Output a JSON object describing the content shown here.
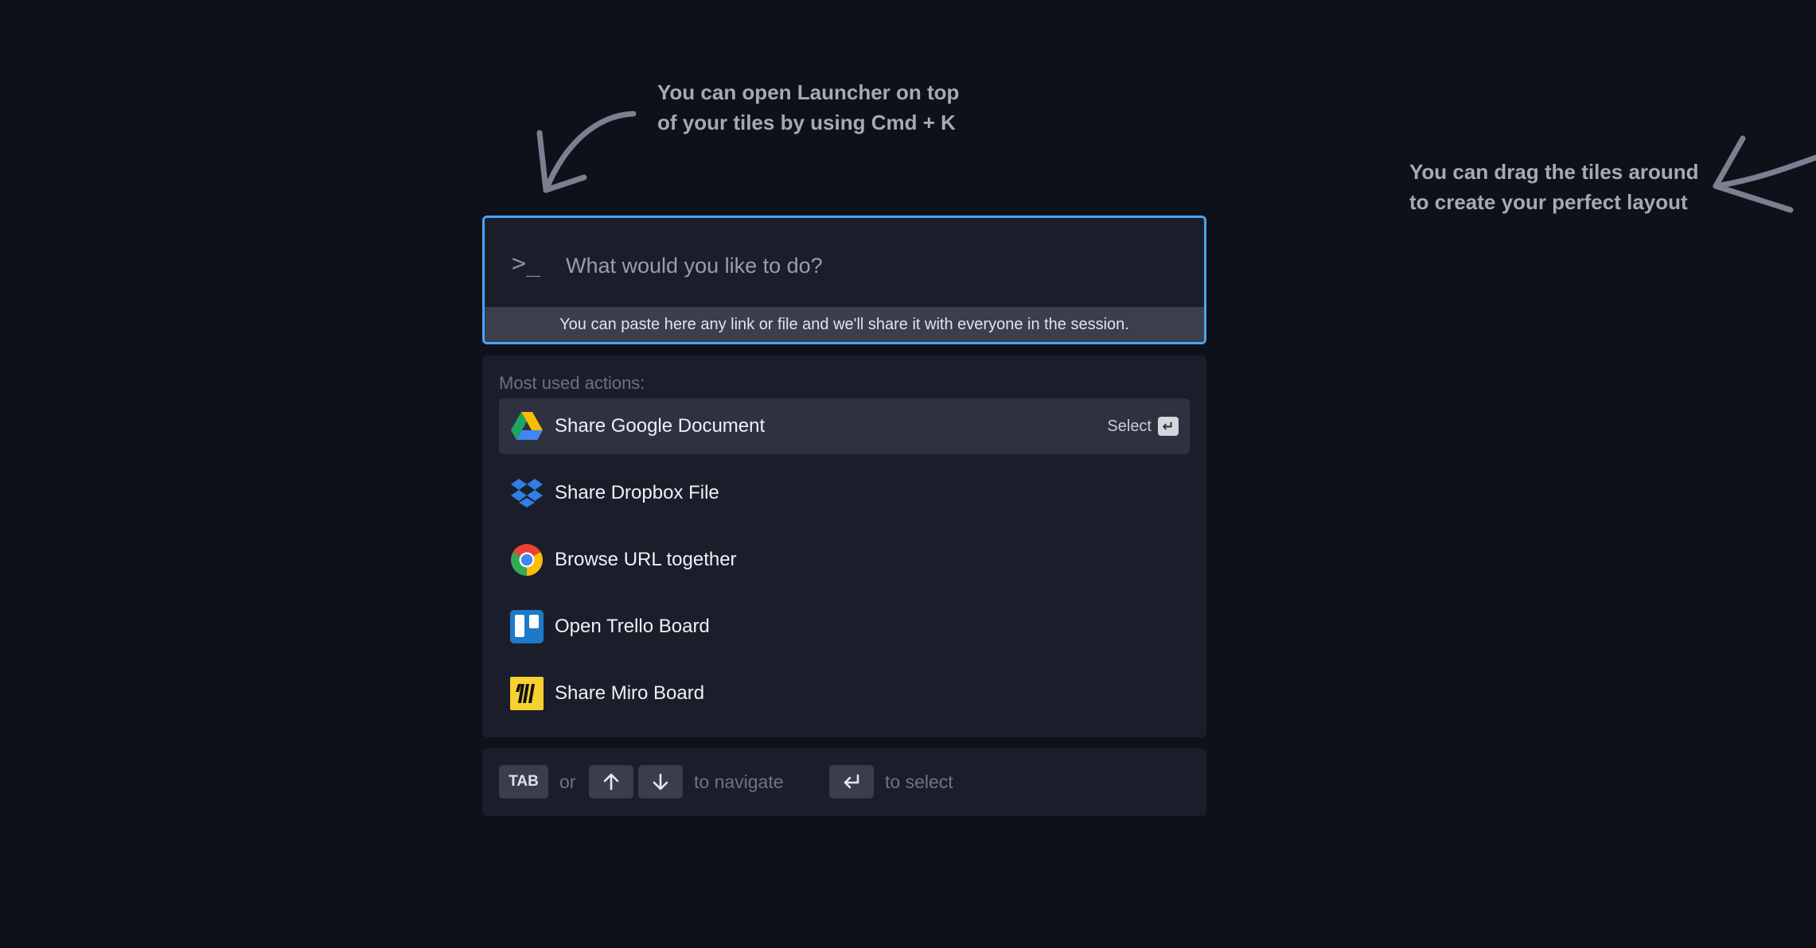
{
  "hints": {
    "top": "You can open Launcher on top\nof your tiles by using Cmd + K",
    "right": "You can drag the tiles around\nto create your perfect layout"
  },
  "launcher": {
    "prompt_icon": "terminal-prompt-icon",
    "prompt_glyph": ">_",
    "placeholder": "What would you like to do?",
    "value": "",
    "paste_hint": "You can paste here any link or file and we'll share it with everyone in the session.",
    "accent_color": "#4da3f0"
  },
  "actions": {
    "heading": "Most used actions:",
    "select_label": "Select",
    "items": [
      {
        "label": "Share Google Document",
        "icon": "google-drive-icon",
        "active": true
      },
      {
        "label": "Share Dropbox File",
        "icon": "dropbox-icon",
        "active": false
      },
      {
        "label": "Browse URL together",
        "icon": "chrome-icon",
        "active": false
      },
      {
        "label": "Open Trello Board",
        "icon": "trello-icon",
        "active": false
      },
      {
        "label": "Share Miro Board",
        "icon": "miro-icon",
        "active": false
      }
    ]
  },
  "nav": {
    "tab_key": "TAB",
    "or": "or",
    "navigate": "to navigate",
    "select": "to select"
  }
}
